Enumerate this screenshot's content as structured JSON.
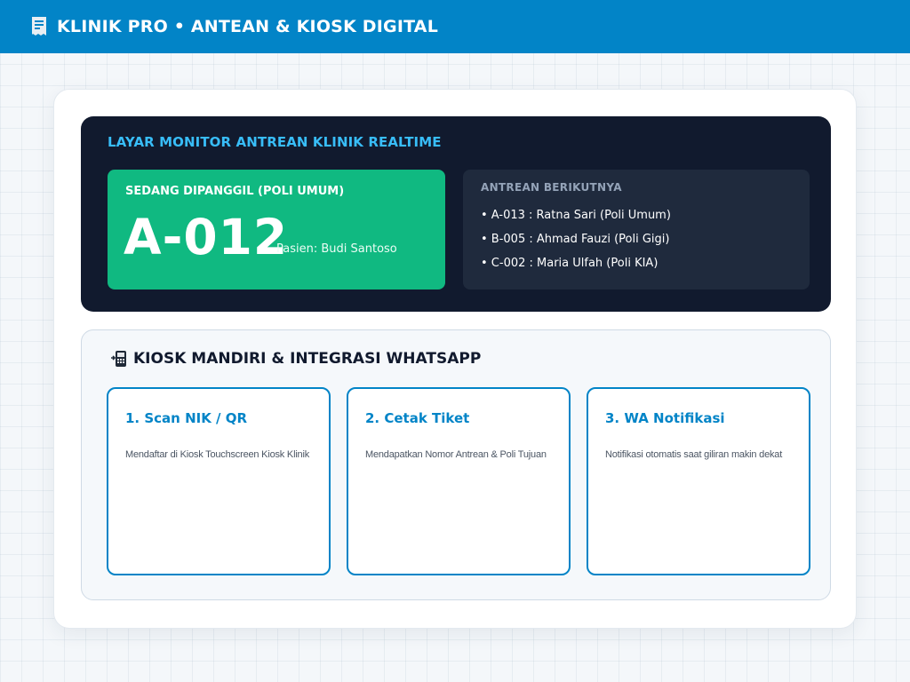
{
  "header": {
    "title": "KLINIK PRO • ANTEAN & KIOSK DIGITAL",
    "logo_icon": "receipt-icon"
  },
  "monitor": {
    "title": "LAYAR MONITOR ANTREAN KLINIK REALTIME",
    "current": {
      "label": "SEDANG DIPANGGIL (POLI UMUM)",
      "number": "A-012",
      "patient": "Pasien: Budi Santoso"
    },
    "next": {
      "label": "ANTREAN BERIKUTNYA",
      "items": [
        "• A-013 : Ratna Sari (Poli Umum)",
        "• B-005 : Ahmad Fauzi (Poli Gigi)",
        "• C-002 : Maria Ulfah (Poli KIA)"
      ]
    }
  },
  "kiosk": {
    "icon": "kiosk-device-icon",
    "title": "KIOSK MANDIRI & INTEGRASI WHATSAPP",
    "steps": [
      {
        "title": "1. Scan NIK / QR",
        "desc": "Mendaftar di Kiosk Touchscreen Kiosk Klinik"
      },
      {
        "title": "2. Cetak Tiket",
        "desc": "Mendapatkan Nomor Antrean & Poli Tujuan"
      },
      {
        "title": "3. WA Notifikasi",
        "desc": "Notifikasi otomatis saat giliran makin dekat"
      }
    ]
  },
  "colors": {
    "brand": "#0284c7",
    "monitor_bg": "#111a2e",
    "current_bg": "#10b981",
    "accent_text": "#38bdf8"
  }
}
